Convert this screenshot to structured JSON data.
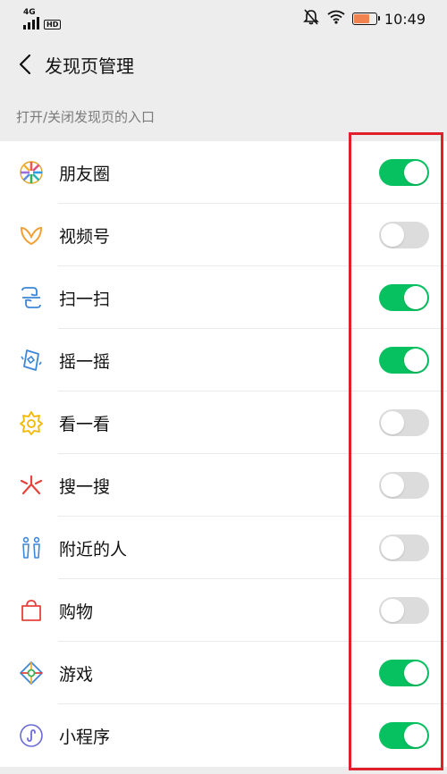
{
  "status_bar": {
    "network": "4G",
    "hd": "HD",
    "time": "10:49",
    "battery_level": 0.7,
    "battery_color": "#f0834f",
    "icons": [
      "mute-icon",
      "wifi-icon",
      "battery-icon"
    ]
  },
  "nav": {
    "title": "发现页管理",
    "back_icon": "chevron-left-icon"
  },
  "section": {
    "header": "打开/关闭发现页的入口"
  },
  "colors": {
    "toggle_on": "#07c160",
    "toggle_off": "#dcdcdc",
    "highlight": "#e0202a"
  },
  "items": [
    {
      "label": "朋友圈",
      "icon": "moments-icon",
      "enabled": true
    },
    {
      "label": "视频号",
      "icon": "channels-icon",
      "enabled": false
    },
    {
      "label": "扫一扫",
      "icon": "scan-icon",
      "enabled": true
    },
    {
      "label": "摇一摇",
      "icon": "shake-icon",
      "enabled": true
    },
    {
      "label": "看一看",
      "icon": "top-stories-icon",
      "enabled": false
    },
    {
      "label": "搜一搜",
      "icon": "search-icon",
      "enabled": false
    },
    {
      "label": "附近的人",
      "icon": "people-nearby-icon",
      "enabled": false
    },
    {
      "label": "购物",
      "icon": "shopping-bag-icon",
      "enabled": false
    },
    {
      "label": "游戏",
      "icon": "games-icon",
      "enabled": true
    },
    {
      "label": "小程序",
      "icon": "mini-programs-icon",
      "enabled": true
    }
  ]
}
